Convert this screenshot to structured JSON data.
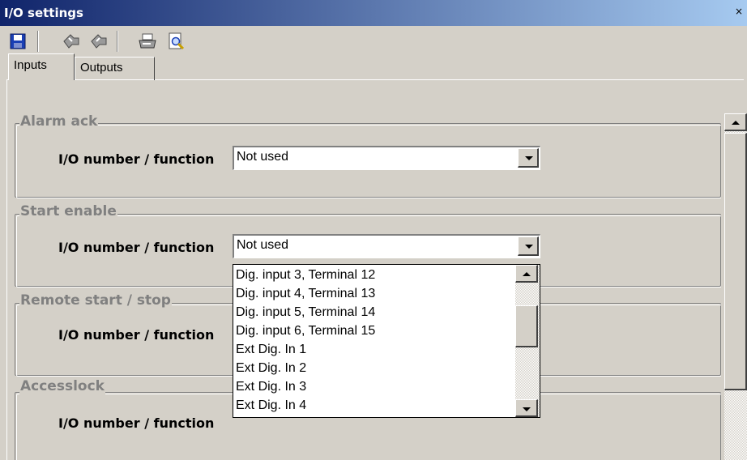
{
  "window": {
    "title": "I/O settings",
    "close_glyph": "×"
  },
  "toolbar": {
    "buttons": [
      {
        "name": "save-icon",
        "color": "#1a3fb5"
      },
      {
        "name": "upload-icon",
        "color": "#808080"
      },
      {
        "name": "download-icon",
        "color": "#808080"
      },
      {
        "name": "print-icon",
        "color": "#808080"
      },
      {
        "name": "print-preview-icon",
        "color": "#3a6ad4"
      }
    ]
  },
  "tabs": [
    {
      "label": "Inputs",
      "active": true
    },
    {
      "label": "Outputs",
      "active": false
    }
  ],
  "groups": [
    {
      "title": "Alarm ack",
      "row_label": "I/O number / function",
      "value": "Not used"
    },
    {
      "title": "Start enable",
      "row_label": "I/O number / function",
      "value": "Not used"
    },
    {
      "title": "Remote start / stop",
      "row_label": "I/O number / function",
      "value": ""
    },
    {
      "title": "Accesslock",
      "row_label": "I/O number / function",
      "value": ""
    }
  ],
  "dropdown": {
    "items": [
      "Dig. input 3, Terminal  12",
      "Dig. input 4, Terminal  13",
      "Dig. input 5, Terminal  14",
      "Dig. input 6, Terminal  15",
      "Ext Dig. In 1",
      "Ext Dig. In 2",
      "Ext Dig. In 3",
      "Ext Dig. In 4"
    ]
  },
  "colors": {
    "titlebar_start": "#10246a",
    "titlebar_end": "#a6caf0",
    "face": "#d4d0c8"
  }
}
